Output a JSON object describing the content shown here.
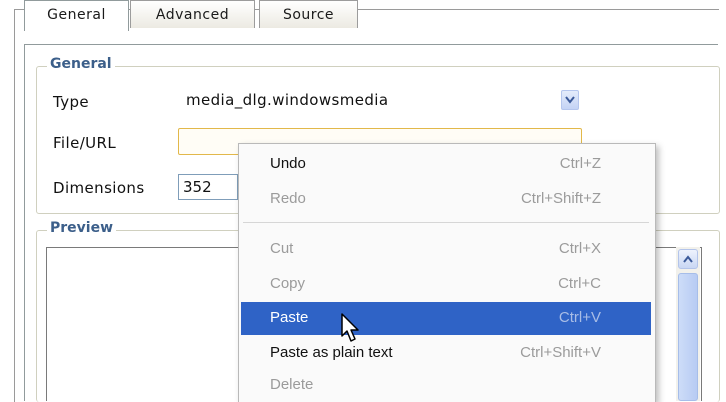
{
  "tabs": [
    {
      "label": "General",
      "active": true
    },
    {
      "label": "Advanced",
      "active": false
    },
    {
      "label": "Source",
      "active": false
    }
  ],
  "general_group": {
    "title": "General",
    "type_label": "Type",
    "type_value": "media_dlg.windowsmedia",
    "file_label": "File/URL",
    "file_value": "",
    "dimensions_label": "Dimensions",
    "dimensions_width": "352"
  },
  "preview_group": {
    "title": "Preview"
  },
  "context_menu": {
    "items": [
      {
        "label": "Undo",
        "shortcut": "Ctrl+Z",
        "enabled": true
      },
      {
        "label": "Redo",
        "shortcut": "Ctrl+Shift+Z",
        "enabled": false
      },
      {
        "label": "Cut",
        "shortcut": "Ctrl+X",
        "enabled": false
      },
      {
        "label": "Copy",
        "shortcut": "Ctrl+C",
        "enabled": false
      },
      {
        "label": "Paste",
        "shortcut": "Ctrl+V",
        "enabled": true,
        "highlighted": true
      },
      {
        "label": "Paste as plain text",
        "shortcut": "Ctrl+Shift+V",
        "enabled": true
      },
      {
        "label": "Delete",
        "shortcut": "",
        "enabled": false
      }
    ]
  },
  "colors": {
    "group_title": "#3c5f8a",
    "menu_highlight": "#2f63c6",
    "focused_input_border": "#e2b84a"
  }
}
